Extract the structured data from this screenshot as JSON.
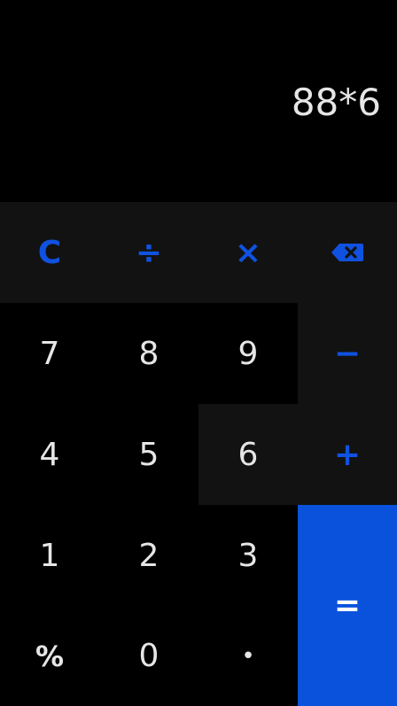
{
  "display": {
    "expression": "88*6"
  },
  "keys": {
    "clear": "C",
    "divide": "÷",
    "multiply": "×",
    "backspace_icon": "backspace-icon",
    "seven": "7",
    "eight": "8",
    "nine": "9",
    "minus": "−",
    "four": "4",
    "five": "5",
    "six": "6",
    "plus": "+",
    "one": "1",
    "two": "2",
    "three": "3",
    "equals": "=",
    "percent": "%",
    "zero": "0",
    "decimal": "•"
  },
  "colors": {
    "accent": "#1052e0",
    "equals_bg": "#0a52dc",
    "key_dark": "#121212",
    "background": "#000000",
    "text": "#e6e6e6"
  }
}
